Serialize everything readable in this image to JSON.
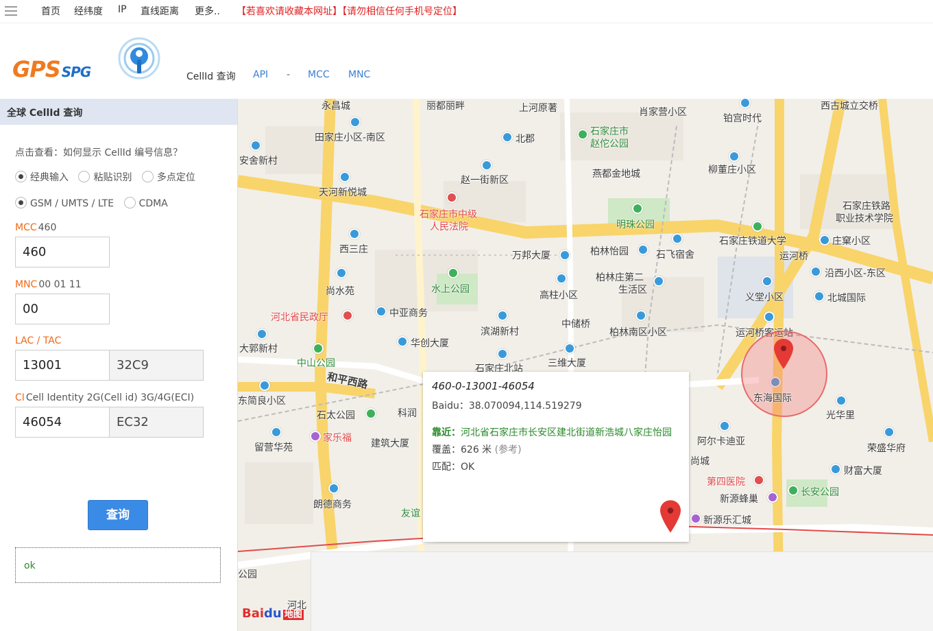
{
  "topnav": {
    "items": [
      "首页",
      "经纬度",
      "IP",
      "直线距离",
      "更多.."
    ],
    "notice": "【若喜欢请收藏本网址】【请勿相信任何手机号定位】"
  },
  "header": {
    "logo_main": "GPS",
    "logo_sub": "SPG",
    "links": [
      "CellId 查询",
      "API",
      "-",
      "MCC",
      "MNC"
    ]
  },
  "panel": {
    "title": "全球 CellId 查询",
    "help": "点击查看：如何显示 CellId 编号信息？",
    "input_modes": [
      "经典输入",
      "粘贴识别",
      "多点定位"
    ],
    "networks": [
      "GSM / UMTS / LTE",
      "CDMA"
    ],
    "mcc": {
      "key": "MCC",
      "hint": "460",
      "value": "460"
    },
    "mnc": {
      "key": "MNC",
      "hint": "00 01 11",
      "value": "00"
    },
    "lac": {
      "key": "LAC / TAC",
      "hint": "",
      "value": "13001",
      "hex": "32C9"
    },
    "ci": {
      "key": "CI",
      "hint": "Cell Identity 2G(Cell id) 3G/4G(ECI)",
      "value": "46054",
      "hex": "EC32"
    },
    "query_label": "查询",
    "result": "ok"
  },
  "map": {
    "labels": [
      "永昌城",
      "丽都丽畔",
      "上河原著",
      "肖家营小区",
      "西古城立交桥",
      "铂宫时代",
      "安舍新村",
      "田家庄小区-南区",
      "北郡",
      "石家庄市",
      "赵佗公园",
      "燕都金地城",
      "柳董庄小区",
      "石家庄铁路",
      "职业技术学院",
      "天河新悦城",
      "赵一街新区",
      "石家庄市中级",
      "人民法院",
      "明珠公园",
      "石家庄铁道大学",
      "庄窠小区",
      "西三庄",
      "万邦大厦",
      "柏林怡园",
      "石飞宿舍",
      "运河桥",
      "沿西小区-东区",
      "尚水苑",
      "水上公园",
      "柏林庄第二",
      "生活区",
      "高柱小区",
      "义堂小区",
      "北城国际",
      "河北省民政厅",
      "中亚商务",
      "滨湖新村",
      "中储桥",
      "柏林南区小区",
      "运河桥客运站",
      "大郭新村",
      "华创大厦",
      "中山公园",
      "石家庄北站",
      "三维大厦",
      "和平西路",
      "东简良小区",
      "东海国际",
      "光华里",
      "石太公园",
      "科润",
      "阿尔卡迪亚",
      "留营华苑",
      "家乐福",
      "建筑大厦",
      "荣盛华府",
      "尚城",
      "财富大厦",
      "第四医院",
      "长安公园",
      "新源蜂巢",
      "朗德商务",
      "友谊",
      "新源乐汇城",
      "公园",
      "河北"
    ],
    "info": {
      "title": "460-0-13001-46054",
      "baidu": "Baidu：38.070094,114.519279",
      "near_key": "靠近：",
      "near": "河北省石家庄市长安区建北街道新浩城八家庄怡园",
      "coverage": "覆盖：626 米",
      "coverage_ref": "(参考)",
      "match": "匹配：OK"
    },
    "logo_bai": "Bai",
    "logo_du": "du",
    "logo_map": "地图"
  }
}
